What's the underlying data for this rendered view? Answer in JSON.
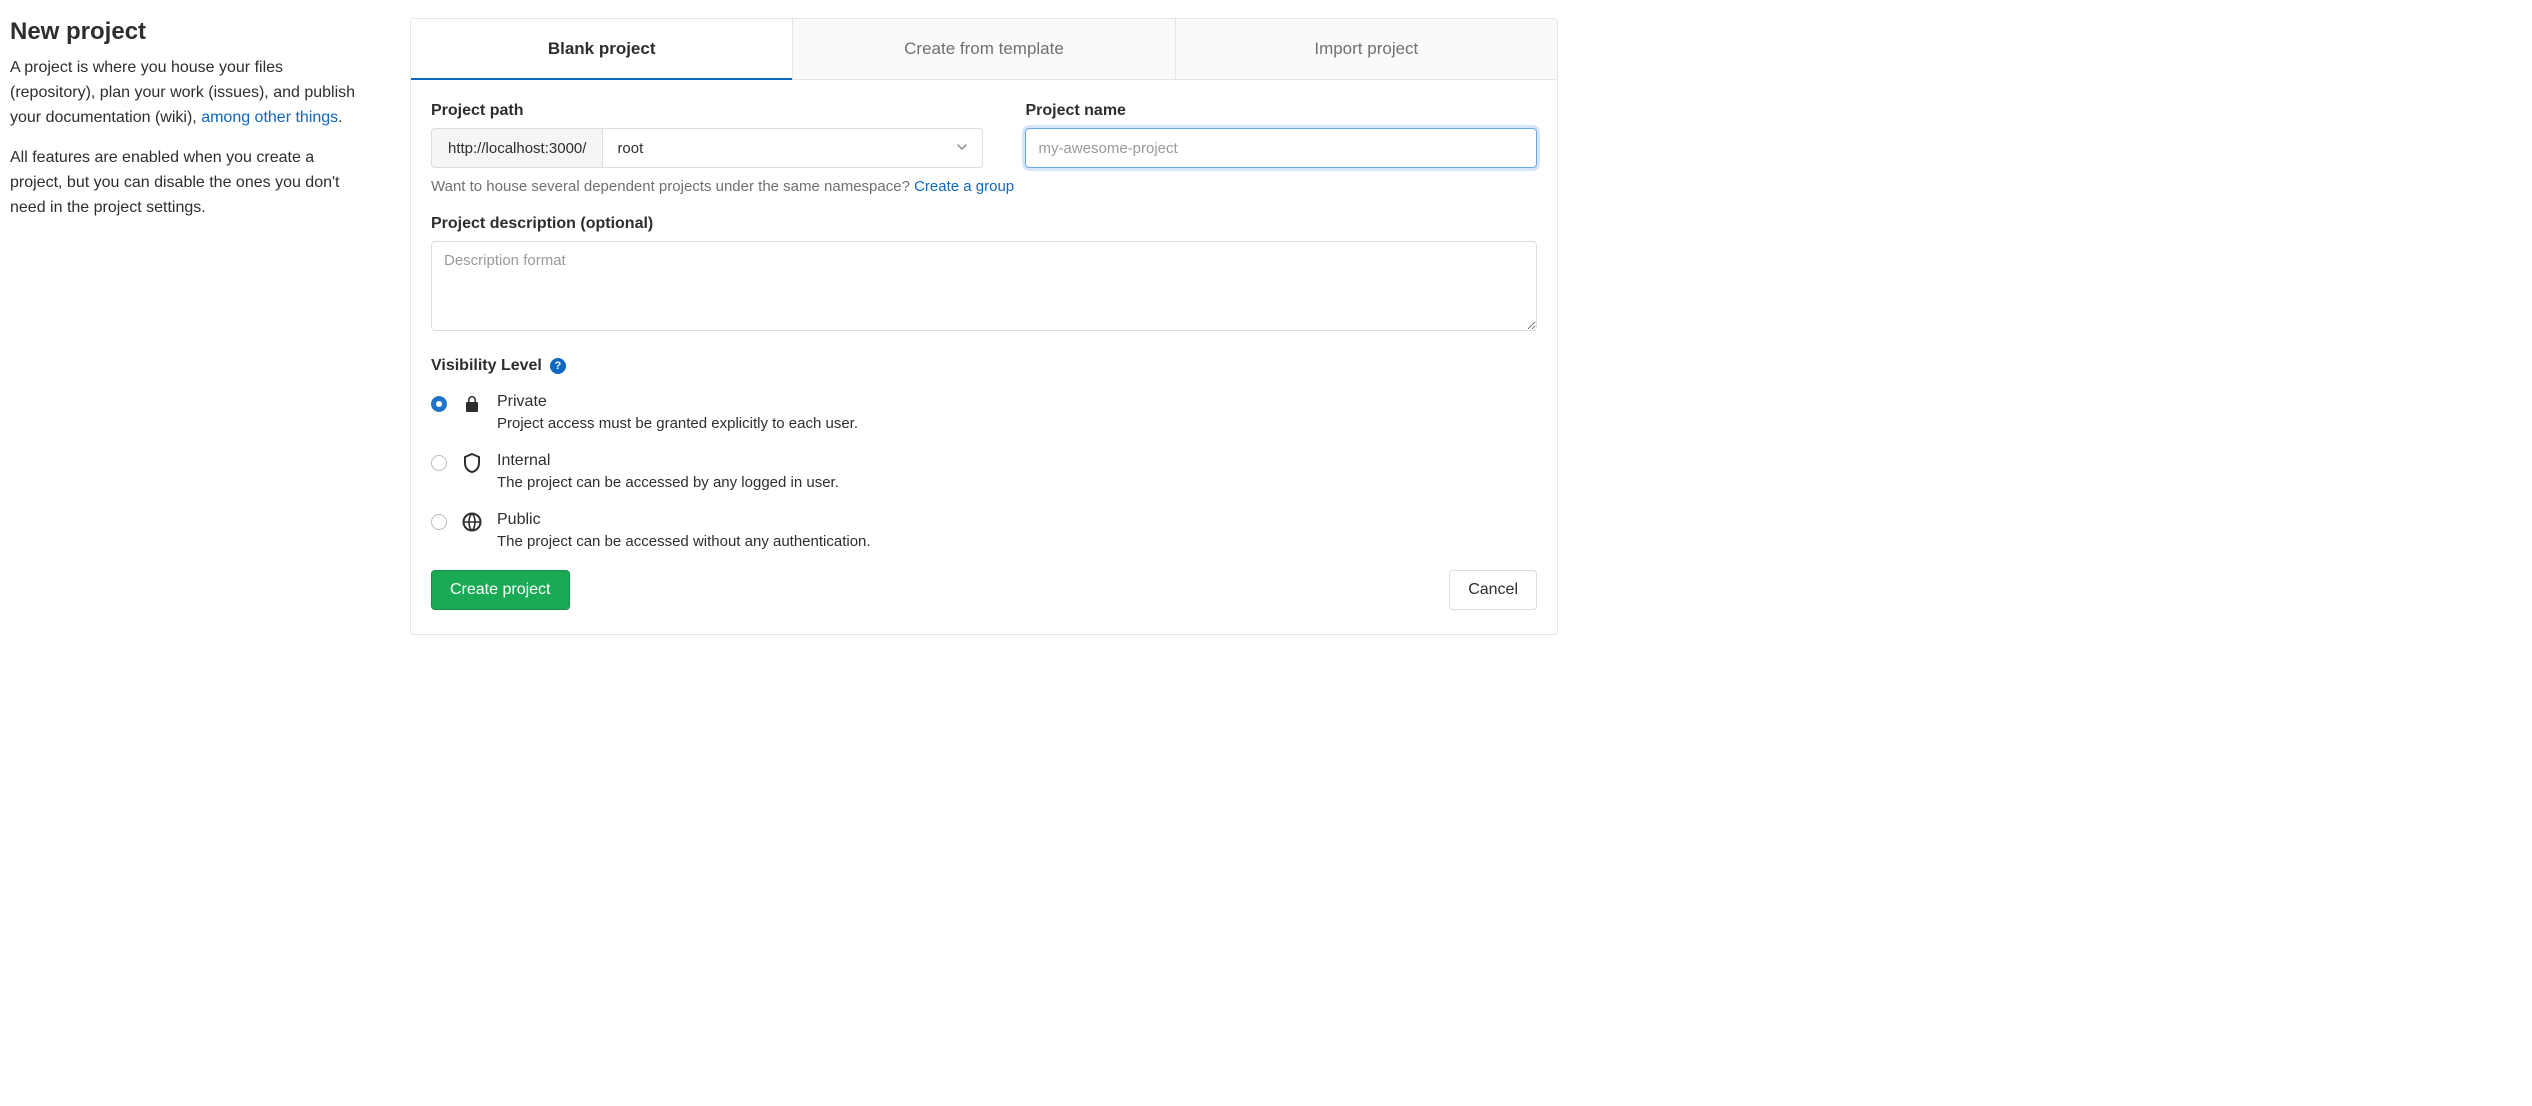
{
  "sidebar": {
    "title": "New project",
    "intro_pre": "A project is where you house your files (repository), plan your work (issues), and publish your documentation (wiki), ",
    "intro_link": "among other things",
    "intro_post": ".",
    "features": "All features are enabled when you create a project, but you can disable the ones you don't need in the project settings."
  },
  "tabs": [
    {
      "label": "Blank project",
      "active": true
    },
    {
      "label": "Create from template",
      "active": false
    },
    {
      "label": "Import project",
      "active": false
    }
  ],
  "form": {
    "path_label": "Project path",
    "path_prefix": "http://localhost:3000/",
    "namespace_selected": "root",
    "name_label": "Project name",
    "name_value": "",
    "name_placeholder": "my-awesome-project",
    "namespace_hint_text": "Want to house several dependent projects under the same namespace? ",
    "namespace_hint_link": "Create a group",
    "description_label": "Project description (optional)",
    "description_value": "",
    "description_placeholder": "Description format",
    "visibility_label": "Visibility Level",
    "visibility_options": [
      {
        "key": "private",
        "label": "Private",
        "desc": "Project access must be granted explicitly to each user.",
        "checked": true
      },
      {
        "key": "internal",
        "label": "Internal",
        "desc": "The project can be accessed by any logged in user.",
        "checked": false
      },
      {
        "key": "public",
        "label": "Public",
        "desc": "The project can be accessed without any authentication.",
        "checked": false
      }
    ],
    "submit_label": "Create project",
    "cancel_label": "Cancel"
  }
}
